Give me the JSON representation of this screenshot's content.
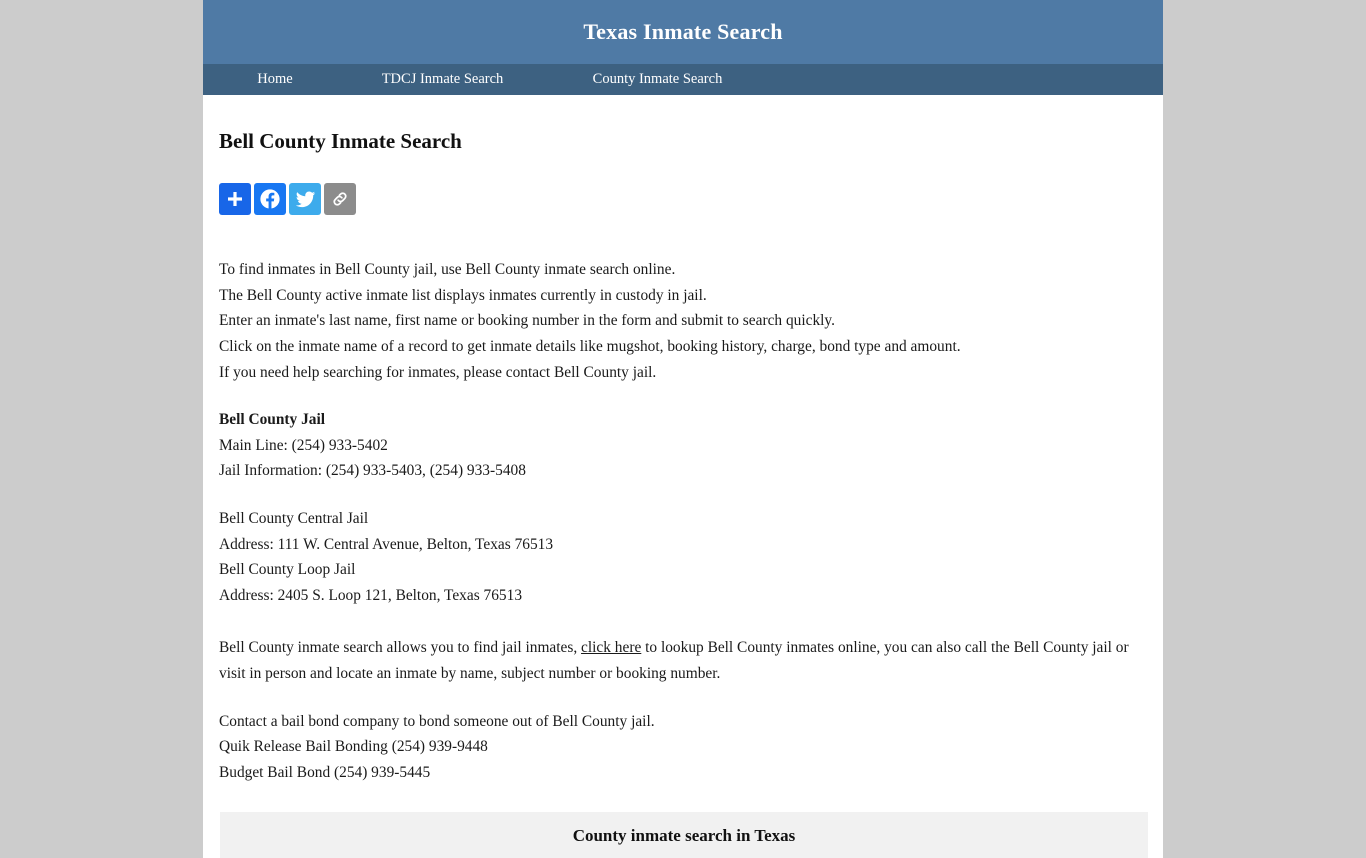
{
  "site": {
    "title": "Texas Inmate Search",
    "header_bg": "#4f7aa5",
    "nav_bg": "#3d6181",
    "page_bg": "#cccccc"
  },
  "nav": {
    "items": [
      {
        "label": "Home"
      },
      {
        "label": "TDCJ Inmate Search"
      },
      {
        "label": "County Inmate Search"
      }
    ]
  },
  "main": {
    "page_title": "Bell County Inmate Search",
    "share": {
      "buttons": [
        {
          "name": "addthis",
          "label": "Share",
          "color": "#1866e8"
        },
        {
          "name": "facebook",
          "label": "Facebook",
          "color": "#1877f2"
        },
        {
          "name": "twitter",
          "label": "Twitter",
          "color": "#3dabec"
        },
        {
          "name": "copy-link",
          "label": "Copy Link",
          "color": "#8c8c8c"
        }
      ]
    },
    "intro_lines": [
      "To find inmates in Bell County jail, use Bell County inmate search online.",
      "The Bell County active inmate list displays inmates currently in custody in jail.",
      "Enter an inmate's last name, first name or booking number in the form and submit to search quickly.",
      "Click on the inmate name of a record to get inmate details like mugshot, booking history, charge, bond type and amount.",
      "If you need help searching for inmates, please contact Bell County jail."
    ],
    "jail_block": {
      "heading": "Bell County Jail",
      "main_line": "Main Line: (254) 933-5402",
      "jail_information": "Jail Information: (254) 933-5403, (254) 933-5408"
    },
    "facilities": [
      {
        "name": "Bell County Central Jail",
        "address": "Address: 111 W. Central Avenue, Belton, Texas 76513"
      },
      {
        "name": "Bell County Loop Jail",
        "address": "Address: 2405 S. Loop 121, Belton, Texas 76513"
      }
    ],
    "search_paragraph": {
      "before_link": "Bell County inmate search allows you to find jail inmates, ",
      "link_text": "click here",
      "after_link": " to lookup Bell County inmates online, you can also call the Bell County jail or visit in person and locate an inmate by name, subject number or booking number."
    },
    "bail_block": {
      "intro": "Contact a bail bond company to bond someone out of Bell County jail.",
      "companies": [
        "Quik Release Bail Bonding (254) 939-9448",
        "Budget Bail Bond (254) 939-5445"
      ]
    },
    "county_table": {
      "header": "County inmate search in Texas"
    }
  }
}
